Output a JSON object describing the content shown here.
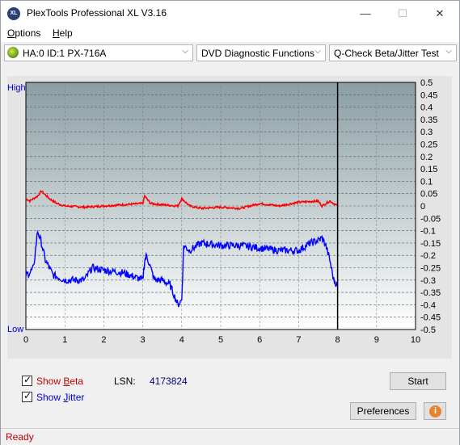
{
  "window": {
    "title": "PlexTools Professional XL V3.16",
    "app_icon_text": "XL"
  },
  "title_buttons": {
    "minimize": "—",
    "maximize": "☐",
    "close": "✕"
  },
  "menu": [
    {
      "label": "Options",
      "underline": "O",
      "rest": "ptions"
    },
    {
      "label": "Help",
      "underline": "H",
      "rest": "elp"
    }
  ],
  "toolbar": {
    "drive": "HA:0 ID:1  PX-716A",
    "function": "DVD Diagnostic Functions",
    "test": "Q-Check Beta/Jitter Test"
  },
  "chart_data": {
    "type": "line",
    "x_ticks": [
      "0",
      "1",
      "2",
      "3",
      "4",
      "5",
      "6",
      "7",
      "8",
      "9",
      "10"
    ],
    "y_right_ticks": [
      "0.5",
      "0.45",
      "0.4",
      "0.35",
      "0.3",
      "0.25",
      "0.2",
      "0.15",
      "0.1",
      "0.05",
      "0",
      "-0.05",
      "-0.1",
      "-0.15",
      "-0.2",
      "-0.25",
      "-0.3",
      "-0.35",
      "-0.4",
      "-0.45",
      "-0.5"
    ],
    "y_left_labels": {
      "top": "High",
      "bottom": "Low"
    },
    "xlim": [
      0,
      10
    ],
    "ylim": [
      -0.5,
      0.5
    ],
    "end_marker_x": 8.0,
    "grid": true,
    "series": [
      {
        "color": "#ff0000",
        "x": [
          0,
          0.1,
          0.3,
          0.4,
          0.6,
          0.8,
          1.0,
          1.5,
          2.0,
          2.5,
          3.0,
          3.05,
          3.2,
          3.5,
          3.9,
          4.0,
          4.2,
          4.5,
          5.0,
          5.5,
          6.0,
          6.5,
          7.0,
          7.5,
          7.6,
          7.8,
          8.0
        ],
        "y": [
          0.03,
          0.02,
          0.04,
          0.06,
          0.03,
          0.01,
          0.0,
          -0.005,
          0.0,
          0.005,
          0.01,
          0.04,
          0.01,
          0.005,
          0.0,
          0.03,
          0.0,
          -0.01,
          -0.005,
          -0.01,
          0.01,
          0.0,
          0.015,
          0.02,
          0.0,
          0.02,
          0.0
        ]
      },
      {
        "color": "#0000ff",
        "x": [
          0,
          0.1,
          0.2,
          0.3,
          0.4,
          0.5,
          0.6,
          0.7,
          1.0,
          1.5,
          1.7,
          2.0,
          2.5,
          3.0,
          3.05,
          3.1,
          3.2,
          3.3,
          3.5,
          3.7,
          3.9,
          4.0,
          4.05,
          4.2,
          4.5,
          5.0,
          5.5,
          6.0,
          6.5,
          7.0,
          7.3,
          7.5,
          7.6,
          7.7,
          7.8,
          7.9,
          8.0
        ],
        "y": [
          -0.28,
          -0.27,
          -0.25,
          -0.1,
          -0.15,
          -0.22,
          -0.25,
          -0.28,
          -0.3,
          -0.3,
          -0.25,
          -0.26,
          -0.27,
          -0.3,
          -0.22,
          -0.2,
          -0.25,
          -0.3,
          -0.3,
          -0.32,
          -0.4,
          -0.38,
          -0.16,
          -0.18,
          -0.15,
          -0.16,
          -0.16,
          -0.17,
          -0.18,
          -0.18,
          -0.15,
          -0.14,
          -0.13,
          -0.16,
          -0.22,
          -0.3,
          -0.32
        ]
      }
    ]
  },
  "bottom": {
    "show_beta": {
      "underline": "B",
      "prefix": "Show ",
      "rest": "eta",
      "label": "Show Beta",
      "checked": true
    },
    "show_jitter": {
      "underline": "J",
      "prefix": "Show ",
      "rest": "itter",
      "label": "Show Jitter",
      "checked": true
    },
    "lsn_label": "LSN:",
    "lsn_value": "4173824",
    "start_button": "Start",
    "preferences_button": "Preferences",
    "info_icon": "info-icon"
  },
  "status": "Ready"
}
